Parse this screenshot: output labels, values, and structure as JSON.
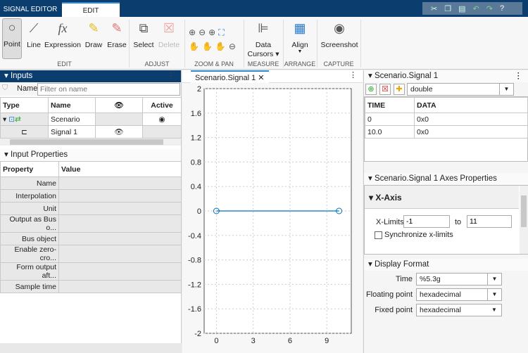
{
  "tabs": [
    "SIGNAL EDITOR",
    "EDIT"
  ],
  "quick_access": [
    "cut-icon",
    "copy-icon",
    "paste-icon",
    "undo-icon",
    "redo-icon",
    "help-icon"
  ],
  "toolstrip": {
    "edit": {
      "items": [
        "Point",
        "Line",
        "Expression",
        "Draw",
        "Erase"
      ],
      "label": "EDIT"
    },
    "adjust": {
      "items": [
        "Select",
        "Delete"
      ],
      "label": "ADJUST"
    },
    "zoom": {
      "label": "ZOOM & PAN"
    },
    "measure": {
      "items": [
        "Data\nCursors ▾"
      ],
      "label": "MEASURE"
    },
    "arrange": {
      "items": [
        "Align"
      ],
      "label": "ARRANGE"
    },
    "capture": {
      "items": [
        "Screenshot"
      ],
      "label": "CAPTURE"
    }
  },
  "inputs": {
    "title": "Inputs",
    "filter_label": "Name",
    "filter_placeholder": "Filter on name",
    "columns": [
      "Type",
      "Name",
      "Active"
    ],
    "rows": [
      {
        "name": "Scenario",
        "active": "◉"
      },
      {
        "name": "Signal 1"
      }
    ]
  },
  "input_properties": {
    "title": "Input Properties",
    "columns": [
      "Property",
      "Value"
    ],
    "rows": [
      "Name",
      "Interpolation",
      "Unit",
      "Output as Bus o...",
      "Bus object",
      "Enable zero-cro...",
      "Form output aft...",
      "Sample time"
    ]
  },
  "plot": {
    "tab": "Scenario.Signal 1"
  },
  "chart_data": {
    "type": "line",
    "xlim": [
      -1,
      11
    ],
    "ylim": [
      -2,
      2
    ],
    "grid": true,
    "xticks": [
      0,
      3,
      6,
      9
    ],
    "yticks": [
      2,
      1.6,
      1.2,
      0.8,
      0.4,
      0,
      -0.4,
      -0.8,
      -1.2,
      -1.6,
      -2
    ],
    "series": [
      {
        "x": [
          0,
          10
        ],
        "y": [
          0,
          0
        ],
        "color": "#0072bd"
      }
    ]
  },
  "signal": {
    "title": "Scenario.Signal 1",
    "type": "double",
    "columns": [
      "TIME",
      "DATA"
    ],
    "rows": [
      [
        "0",
        "0x0"
      ],
      [
        "10.0",
        "0x0"
      ]
    ]
  },
  "axes": {
    "title": "Scenario.Signal 1 Axes Properties",
    "section": "X-Axis",
    "xlimits_label": "X-Limits",
    "xmin": "-1",
    "to": "to",
    "xmax": "11",
    "sync": "Synchronize x-limits"
  },
  "display": {
    "title": "Display Format",
    "time_label": "Time",
    "time": "%5.3g",
    "float_label": "Floating point",
    "float": "hexadecimal",
    "fixed_label": "Fixed point",
    "fixed": "hexadecimal"
  }
}
